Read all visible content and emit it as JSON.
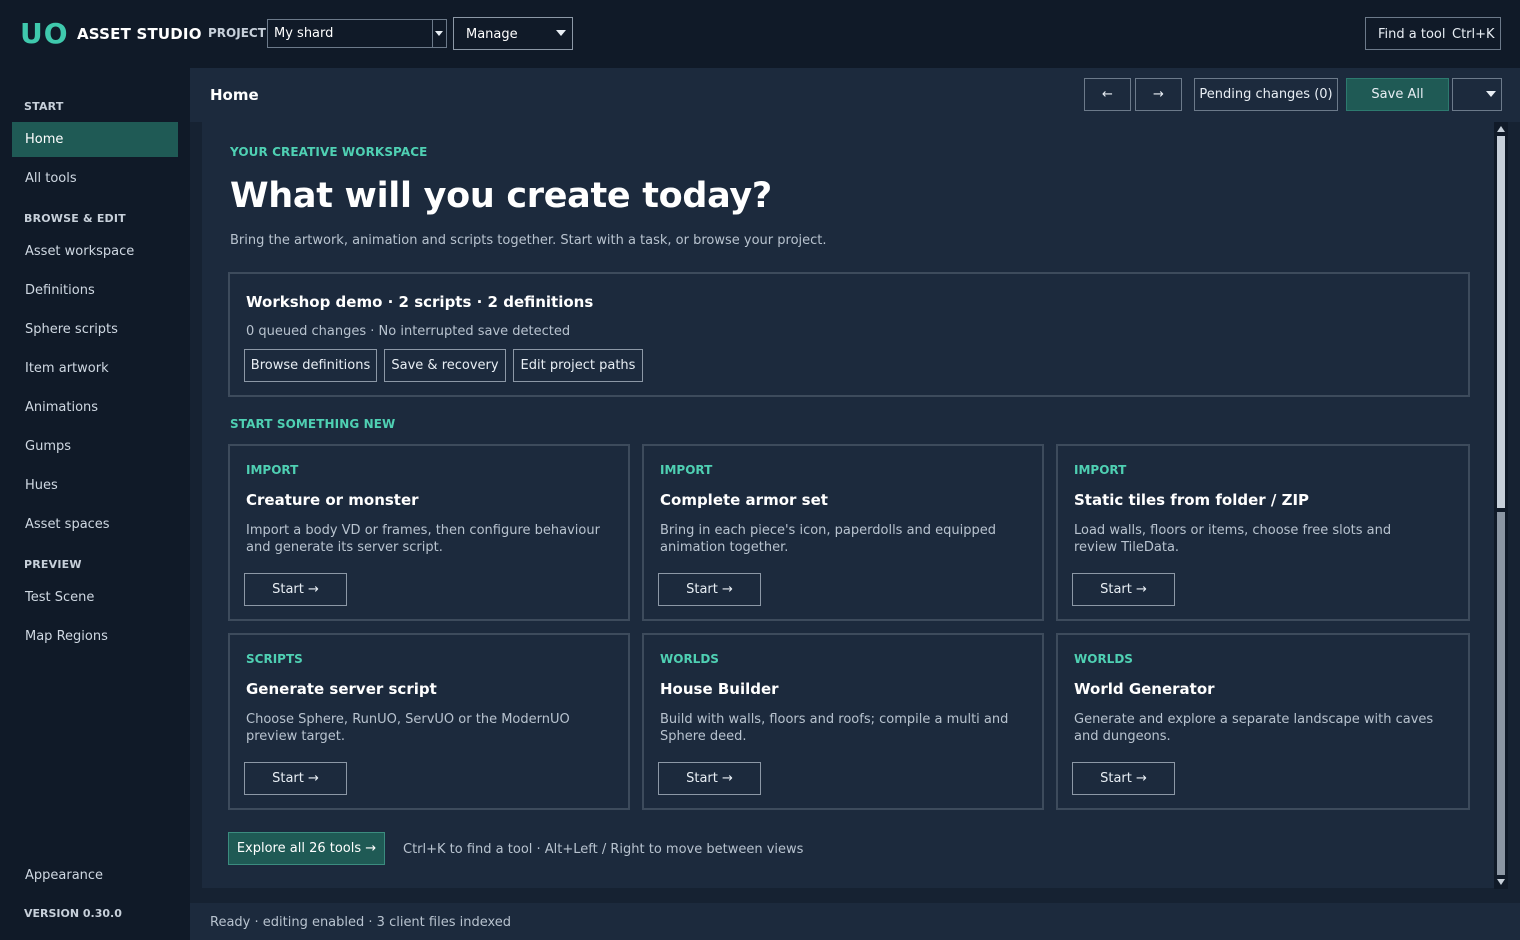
{
  "app": {
    "logo_mark": "UO",
    "logo_text": "ASSET STUDIO",
    "project_label": "PROJECT",
    "project_value": "My shard",
    "manage_value": "Manage",
    "find_tool_label": "Find a tool",
    "find_tool_shortcut": "Ctrl+K"
  },
  "sidebar": {
    "section_start": "START",
    "section_browse": "BROWSE & EDIT",
    "section_preview": "PREVIEW",
    "items": [
      {
        "label": "Home",
        "active": true
      },
      {
        "label": "All tools"
      },
      {
        "label": "Asset workspace"
      },
      {
        "label": "Definitions"
      },
      {
        "label": "Sphere scripts"
      },
      {
        "label": "Item artwork"
      },
      {
        "label": "Animations"
      },
      {
        "label": "Gumps"
      },
      {
        "label": "Hues"
      },
      {
        "label": "Asset spaces"
      },
      {
        "label": "Test Scene"
      },
      {
        "label": "Map Regions"
      }
    ],
    "appearance": "Appearance",
    "version": "VERSION 0.30.0"
  },
  "header": {
    "title": "Home",
    "back_icon": "←",
    "forward_icon": "→",
    "pending": "Pending changes (0)",
    "save_all": "Save All"
  },
  "hero": {
    "eyebrow": "YOUR CREATIVE WORKSPACE",
    "title": "What will you create today?",
    "subtitle": "Bring the artwork, animation and scripts together. Start with a task, or browse your project."
  },
  "project_panel": {
    "title": "Workshop demo · 2 scripts · 2 definitions",
    "meta": "0 queued changes · No interrupted save detected",
    "buttons": [
      "Browse definitions",
      "Save & recovery",
      "Edit project paths"
    ]
  },
  "start_section": {
    "heading": "START SOMETHING NEW",
    "start_label": "Start  →",
    "cards": [
      {
        "kind": "IMPORT",
        "title": "Creature or monster",
        "desc": "Import a body VD or frames, then configure behaviour and generate its server script."
      },
      {
        "kind": "IMPORT",
        "title": "Complete armor set",
        "desc": "Bring in each piece's icon, paperdolls and equipped animation together."
      },
      {
        "kind": "IMPORT",
        "title": "Static tiles from folder / ZIP",
        "desc": "Load walls, floors or items, choose free slots and review TileData."
      },
      {
        "kind": "SCRIPTS",
        "title": "Generate server script",
        "desc": "Choose Sphere, RunUO, ServUO or the ModernUO preview target."
      },
      {
        "kind": "WORLDS",
        "title": "House Builder",
        "desc": "Build with walls, floors and roofs; compile a multi and Sphere deed."
      },
      {
        "kind": "WORLDS",
        "title": "World Generator",
        "desc": "Generate and explore a separate landscape with caves and dungeons."
      }
    ]
  },
  "footer": {
    "explore": "Explore all 26 tools  →",
    "hint": "Ctrl+K to find a tool · Alt+Left / Right to move between views"
  },
  "status": {
    "text": "Ready · editing enabled · 3 client files indexed"
  }
}
